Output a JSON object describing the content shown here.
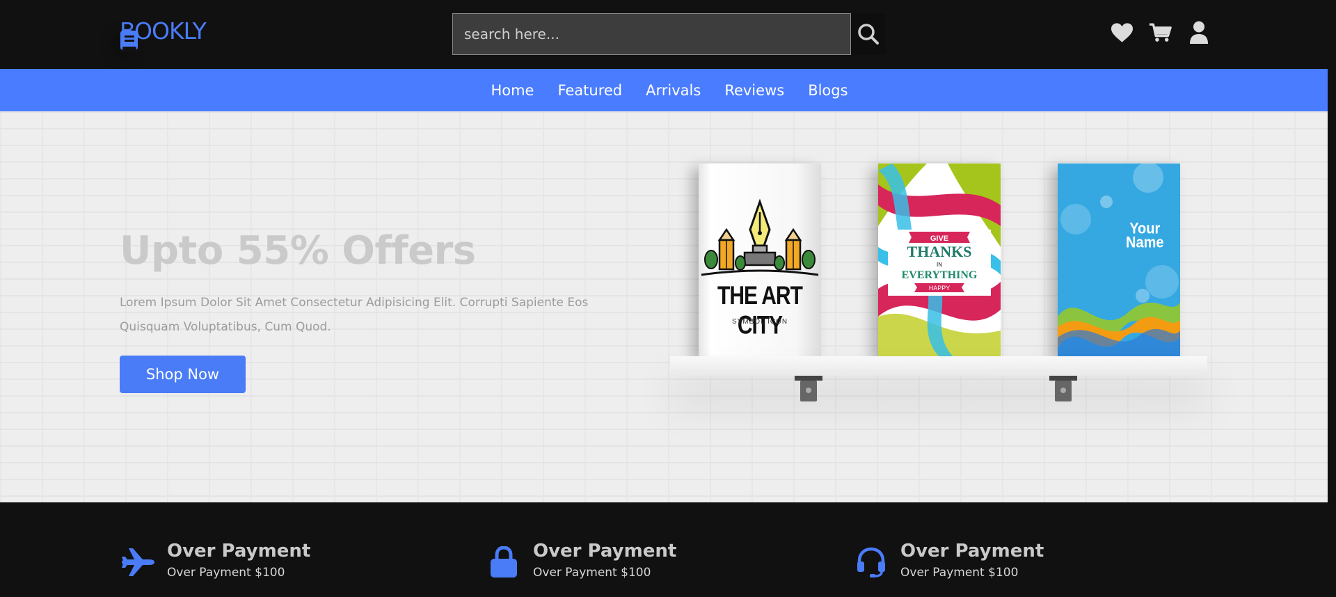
{
  "header": {
    "logo_text": "BOOKLY",
    "search": {
      "placeholder": "search here..."
    },
    "icons": [
      "heart-icon",
      "cart-icon",
      "user-icon"
    ]
  },
  "nav": {
    "items": [
      {
        "label": "Home"
      },
      {
        "label": "Featured"
      },
      {
        "label": "Arrivals"
      },
      {
        "label": "Reviews"
      },
      {
        "label": "Blogs"
      }
    ]
  },
  "hero": {
    "title": "Upto 55% Offers",
    "text": "Lorem Ipsum Dolor Sit Amet Consectetur Adipisicing Elit. Corrupti Sapiente Eos Quisquam Voluptatibus, Cum Quod.",
    "button_label": "Shop Now",
    "books": [
      {
        "title": "THE ART CITY",
        "subtitle": "SYMBOL ICON"
      },
      {
        "line1": "GIVE",
        "line2": "THANKS",
        "line3": "IN",
        "line4": "EVERYTHING",
        "line5": "HAPPY"
      },
      {
        "line1": "Your",
        "line2": "Name"
      }
    ]
  },
  "features": [
    {
      "icon": "plane-icon",
      "title": "Over Payment",
      "subtitle": "Over Payment $100"
    },
    {
      "icon": "lock-icon",
      "title": "Over Payment",
      "subtitle": "Over Payment $100"
    },
    {
      "icon": "headset-icon",
      "title": "Over Payment",
      "subtitle": "Over Payment $100"
    }
  ],
  "colors": {
    "accent": "#4a7cf7",
    "nav_bg": "#4a7cff",
    "header_bg": "#111111",
    "hero_bg": "#eeeeee"
  }
}
